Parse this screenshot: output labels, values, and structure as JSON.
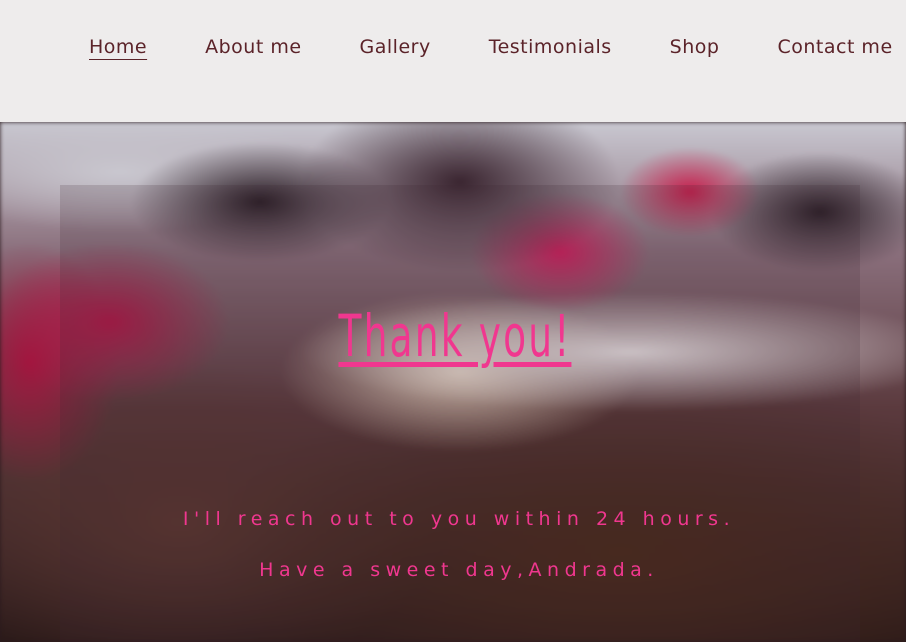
{
  "nav": {
    "items": [
      {
        "label": "Home",
        "active": true
      },
      {
        "label": "About me",
        "active": false
      },
      {
        "label": "Gallery",
        "active": false
      },
      {
        "label": "Testimonials",
        "active": false
      },
      {
        "label": "Shop",
        "active": false
      },
      {
        "label": "Contact me",
        "active": false
      }
    ]
  },
  "hero": {
    "title": "Thank you!",
    "line1": "I'll reach out to you within 24 hours.",
    "line2": "Have a sweet day,Andrada."
  },
  "colors": {
    "nav_text": "#5b2329",
    "header_bg": "#eeecec",
    "accent_pink": "#f0378f"
  }
}
